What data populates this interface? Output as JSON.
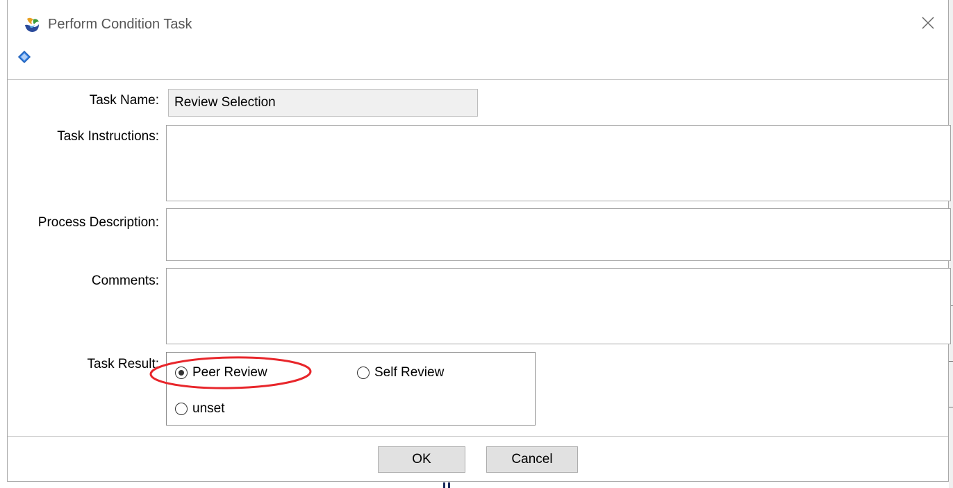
{
  "window": {
    "title": "Perform Condition Task",
    "app_icon": "app-logo-icon",
    "close_icon": "close-icon"
  },
  "toolbar": {
    "icon": "diamond-icon"
  },
  "form": {
    "task_name": {
      "label": "Task Name:",
      "value": "Review Selection"
    },
    "task_instructions": {
      "label": "Task Instructions:",
      "value": ""
    },
    "process_description": {
      "label": "Process Description:",
      "value": ""
    },
    "comments": {
      "label": "Comments:",
      "value": ""
    },
    "task_result": {
      "label": "Task Result:",
      "options": [
        {
          "label": "Peer Review",
          "selected": true
        },
        {
          "label": "Self Review",
          "selected": false
        },
        {
          "label": "unset",
          "selected": false
        }
      ]
    }
  },
  "buttons": {
    "ok": "OK",
    "cancel": "Cancel"
  },
  "colors": {
    "highlight": "#e8262b",
    "diamond": "#1e6fd9",
    "button_bg": "#e1e1e1"
  }
}
